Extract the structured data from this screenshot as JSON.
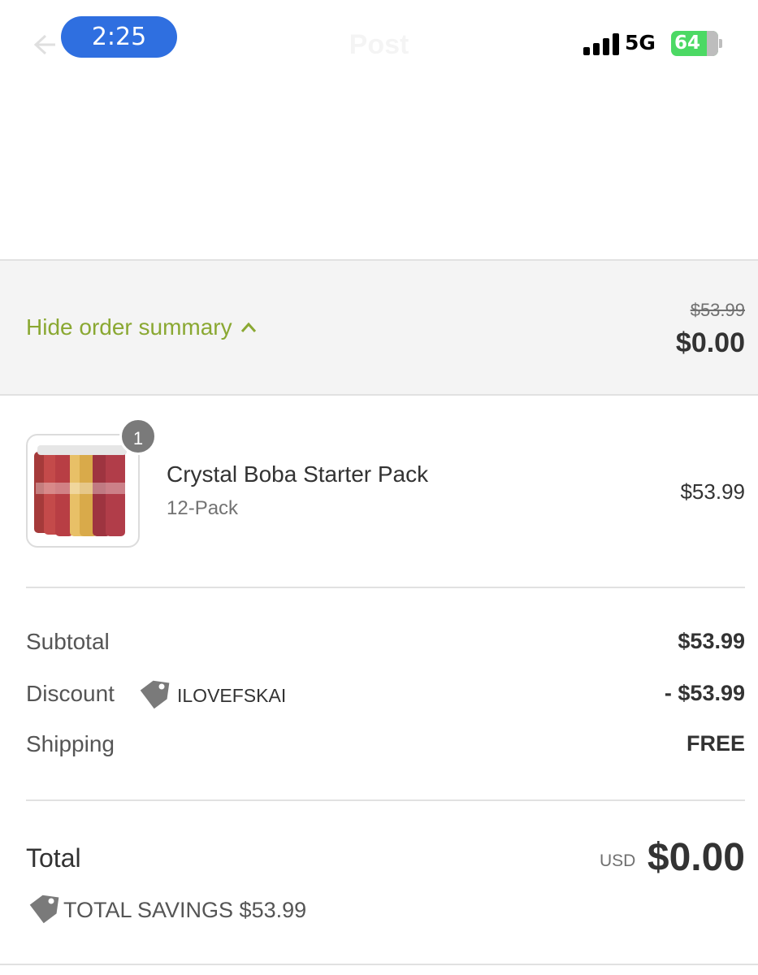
{
  "status_bar": {
    "time": "2:25",
    "network": "5G",
    "battery": "64"
  },
  "nav": {
    "title": "Post"
  },
  "summary_bar": {
    "toggle_label": "Hide order summary",
    "original_total": "$53.99",
    "total": "$0.00"
  },
  "cart": {
    "items": [
      {
        "quantity": "1",
        "name": "Crystal Boba Starter Pack",
        "variant": "12-Pack",
        "price": "$53.99"
      }
    ]
  },
  "costs": {
    "subtotal_label": "Subtotal",
    "subtotal_value": "$53.99",
    "discount_label": "Discount",
    "discount_code": "ILOVEFSKAI",
    "discount_value": "- $53.99",
    "shipping_label": "Shipping",
    "shipping_value": "FREE"
  },
  "total": {
    "label": "Total",
    "currency": "USD",
    "value": "$0.00",
    "savings": "TOTAL SAVINGS $53.99"
  },
  "colors": {
    "accent_green": "#8aa832",
    "time_pill": "#2f6fe0",
    "battery_green": "#4cd964"
  }
}
